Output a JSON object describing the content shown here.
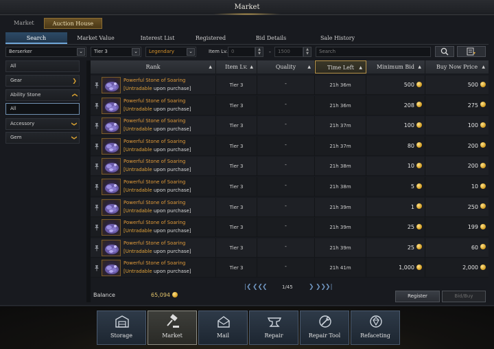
{
  "window": {
    "title": "Market"
  },
  "main_tabs": [
    {
      "label": "Market",
      "active": false
    },
    {
      "label": "Auction House",
      "active": true
    }
  ],
  "sub_tabs": [
    {
      "label": "Search",
      "active": true
    },
    {
      "label": "Market Value",
      "active": false
    },
    {
      "label": "Interest List",
      "active": false
    },
    {
      "label": "Registered",
      "active": false
    },
    {
      "label": "Bid Details",
      "active": false
    },
    {
      "label": "Sale History",
      "active": false
    }
  ],
  "filters": {
    "class": "Berserker",
    "tier": "Tier 3",
    "grade": "Legendary",
    "item_lv_label": "Item Lv.",
    "item_lv_min": "0",
    "item_lv_max": "1500",
    "range_separator": "-",
    "search_placeholder": "Search"
  },
  "sidebar": {
    "items": [
      {
        "label": "All",
        "expandable": false,
        "selected": false
      },
      {
        "label": "Gear",
        "expandable": true,
        "expanded": false
      },
      {
        "label": "Ability Stone",
        "expandable": true,
        "expanded": true
      },
      {
        "label": "All",
        "sub": true,
        "selected": true
      },
      {
        "label": "Accessory",
        "expandable": true,
        "expanded": false
      },
      {
        "label": "Gem",
        "expandable": true,
        "expanded": false
      }
    ]
  },
  "table": {
    "columns": [
      "Rank",
      "Item Lv.",
      "Quality",
      "Time Left",
      "Minimum Bid",
      "Buy Now Price"
    ],
    "active_sort": "Time Left",
    "rows": [
      {
        "name": "Powerful Stone of Soaring",
        "note_bracket": "[Untradable",
        "note_rest": " upon purchase]",
        "tier": "Tier 3",
        "quality": "-",
        "time_left": "21h 36m",
        "min_bid": "500",
        "buy_now": "500"
      },
      {
        "name": "Powerful Stone of Soaring",
        "note_bracket": "[Untradable",
        "note_rest": " upon purchase]",
        "tier": "Tier 3",
        "quality": "-",
        "time_left": "21h 36m",
        "min_bid": "208",
        "buy_now": "275"
      },
      {
        "name": "Powerful Stone of Soaring",
        "note_bracket": "[Untradable",
        "note_rest": " upon purchase]",
        "tier": "Tier 3",
        "quality": "-",
        "time_left": "21h 37m",
        "min_bid": "100",
        "buy_now": "100"
      },
      {
        "name": "Powerful Stone of Soaring",
        "note_bracket": "[Untradable",
        "note_rest": " upon purchase]",
        "tier": "Tier 3",
        "quality": "-",
        "time_left": "21h 37m",
        "min_bid": "80",
        "buy_now": "200"
      },
      {
        "name": "Powerful Stone of Soaring",
        "note_bracket": "[Untradable",
        "note_rest": " upon purchase]",
        "tier": "Tier 3",
        "quality": "-",
        "time_left": "21h 38m",
        "min_bid": "10",
        "buy_now": "200"
      },
      {
        "name": "Powerful Stone of Soaring",
        "note_bracket": "[Untradable",
        "note_rest": " upon purchase]",
        "tier": "Tier 3",
        "quality": "-",
        "time_left": "21h 38m",
        "min_bid": "5",
        "buy_now": "10"
      },
      {
        "name": "Powerful Stone of Soaring",
        "note_bracket": "[Untradable",
        "note_rest": " upon purchase]",
        "tier": "Tier 3",
        "quality": "-",
        "time_left": "21h 39m",
        "min_bid": "1",
        "buy_now": "250"
      },
      {
        "name": "Powerful Stone of Soaring",
        "note_bracket": "[Untradable",
        "note_rest": " upon purchase]",
        "tier": "Tier 3",
        "quality": "-",
        "time_left": "21h 39m",
        "min_bid": "25",
        "buy_now": "199"
      },
      {
        "name": "Powerful Stone of Soaring",
        "note_bracket": "[Untradable",
        "note_rest": " upon purchase]",
        "tier": "Tier 3",
        "quality": "-",
        "time_left": "21h 39m",
        "min_bid": "25",
        "buy_now": "60"
      },
      {
        "name": "Powerful Stone of Soaring",
        "note_bracket": "[Untradable",
        "note_rest": " upon purchase]",
        "tier": "Tier 3",
        "quality": "-",
        "time_left": "21h 41m",
        "min_bid": "1,000",
        "buy_now": "2,000"
      }
    ]
  },
  "pagination": {
    "page": "1/45"
  },
  "footer": {
    "balance_label": "Balance",
    "balance_value": "65,094",
    "register_label": "Register",
    "bidbuy_label": "Bid/Buy"
  },
  "dock": [
    {
      "label": "Storage",
      "icon": "storage-icon",
      "active": false
    },
    {
      "label": "Market",
      "icon": "gavel-icon",
      "active": true
    },
    {
      "label": "Mail",
      "icon": "mail-icon",
      "active": false
    },
    {
      "label": "Repair",
      "icon": "anvil-icon",
      "active": false
    },
    {
      "label": "Repair Tool",
      "icon": "repair-tool-icon",
      "active": false
    },
    {
      "label": "Refaceting",
      "icon": "faceting-icon",
      "active": false
    }
  ],
  "colors": {
    "accent_gold": "#c9a552",
    "tab_blue": "#6fa6d8",
    "item_name": "#e09a3a",
    "legendary": "#d4912a",
    "balance": "#e2c36a"
  }
}
